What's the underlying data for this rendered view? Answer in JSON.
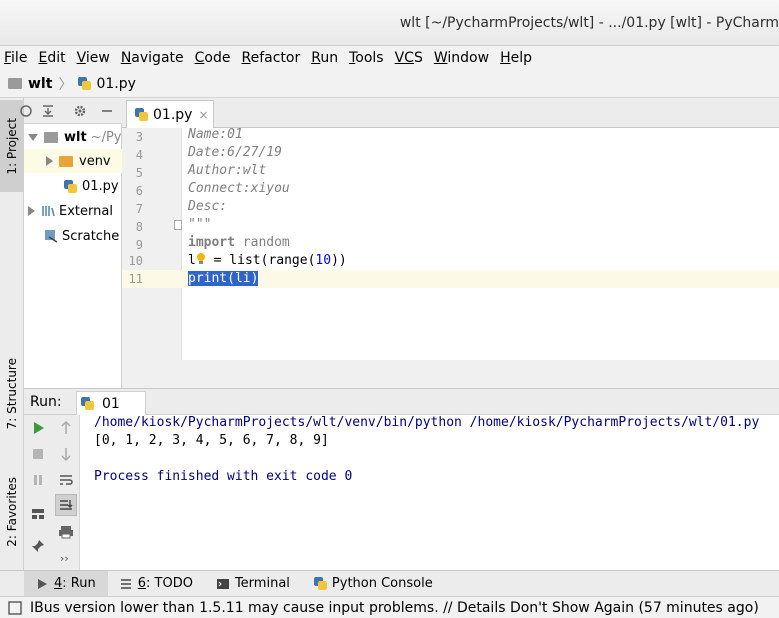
{
  "window": {
    "title": "wlt [~/PycharmProjects/wlt] - .../01.py [wlt] - PyCharm"
  },
  "menu": [
    {
      "key": "F",
      "rest": "ile"
    },
    {
      "key": "E",
      "rest": "dit"
    },
    {
      "key": "V",
      "rest": "iew"
    },
    {
      "key": "N",
      "rest": "avigate"
    },
    {
      "key": "C",
      "rest": "ode"
    },
    {
      "key": "R",
      "rest": "efactor"
    },
    {
      "key": "R",
      "rest": "un",
      "full": "Run"
    },
    {
      "key": "T",
      "rest": "ools"
    },
    {
      "key": "VC",
      "rest": "S"
    },
    {
      "key": "W",
      "rest": "indow"
    },
    {
      "key": "H",
      "rest": "elp"
    }
  ],
  "breadcrumb": {
    "project": "wlt",
    "file": "01.py"
  },
  "left_tabs": {
    "project": "1: Project",
    "structure": "7: Structure",
    "favorites": "2: Favorites"
  },
  "project_tree": {
    "root_name": "wlt",
    "root_path": "~/Py",
    "venv": "venv",
    "file": "01.py",
    "external": "External",
    "scratches": "Scratche"
  },
  "editor": {
    "tab_label": "01.py",
    "tab_close": "×",
    "lines": [
      {
        "num": "3",
        "text": "Name:01"
      },
      {
        "num": "4",
        "text": "Date:6/27/19"
      },
      {
        "num": "5",
        "text": "Author:wlt"
      },
      {
        "num": "6",
        "text": "Connect:xiyou"
      },
      {
        "num": "7",
        "text": "Desc:"
      },
      {
        "num": "8",
        "text": "\"\"\""
      },
      {
        "num": "9",
        "kw": "import",
        "text": " random"
      },
      {
        "num": "10",
        "var_a": "l",
        "var_b": "",
        "rest": " = list(range(",
        "n": "10",
        "end": "))"
      },
      {
        "num": "11",
        "text": "print(li)"
      }
    ]
  },
  "run": {
    "label": "Run:",
    "tab": "01",
    "output": [
      "/home/kiosk/PycharmProjects/wlt/venv/bin/python /home/kiosk/PycharmProjects/wlt/01.py",
      "[0, 1, 2, 3, 4, 5, 6, 7, 8, 9]",
      "",
      "Process finished with exit code 0"
    ]
  },
  "bottom_tabs": {
    "run_num": "4",
    "run": ": Run",
    "todo_num": "6",
    "todo": ": TODO",
    "terminal": "Terminal",
    "console": "Python Console"
  },
  "status": {
    "message": "IBus version lower than 1.5.11 may cause input problems. // Details Don't Show Again (57 minutes ago)"
  },
  "colors": {
    "keyword": "#000080",
    "comment": "#808080",
    "number": "#0000ff",
    "selection": "#2f65ca",
    "output": "#00007f"
  }
}
